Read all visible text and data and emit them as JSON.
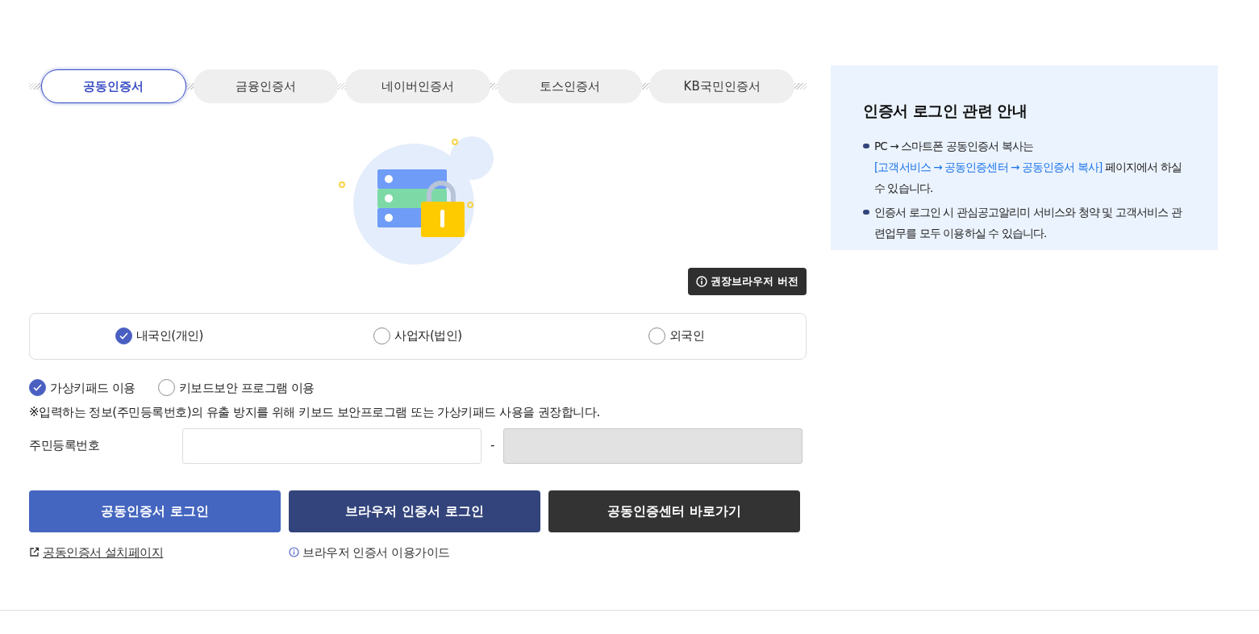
{
  "tabs": [
    {
      "label": "공동인증서",
      "selected": true
    },
    {
      "label": "금융인증서",
      "selected": false
    },
    {
      "label": "네이버인증서",
      "selected": false
    },
    {
      "label": "토스인증서",
      "selected": false
    },
    {
      "label": "KB국민인증서",
      "selected": false
    }
  ],
  "browser_version_button": {
    "label": "권장브라우저 버전"
  },
  "member_types": [
    {
      "label": "내국인(개인)",
      "selected": true
    },
    {
      "label": "사업자(법인)",
      "selected": false
    },
    {
      "label": "외국인",
      "selected": false
    }
  ],
  "input_methods": [
    {
      "label": "가상키패드 이용",
      "selected": true
    },
    {
      "label": "키보드보안 프로그램 이용",
      "selected": false
    }
  ],
  "notice": "※입력하는 정보(주민등록번호)의 유출 방지를 위해 키보드 보안프로그램 또는 가상키패드 사용을 권장합니다.",
  "resident_number": {
    "label": "주민등록번호",
    "separator": "-",
    "fields": [
      {
        "disabled": false
      },
      {
        "disabled": true
      }
    ]
  },
  "buttons": [
    {
      "label": "공동인증서 로그인",
      "kind": "primary"
    },
    {
      "label": "브라우저 인증서 로그인",
      "kind": "navy"
    },
    {
      "label": "공동인증센터 바로가기",
      "kind": "dark"
    }
  ],
  "links": [
    {
      "label": "공동인증서 설치페이지",
      "kind": "external"
    },
    {
      "label": "브라우저 인증서 이용가이드",
      "kind": "info"
    }
  ],
  "guide": {
    "title": "인증서 로그인 관련 안내",
    "items": [
      {
        "before": "PC → 스마트폰 공동인증서 복사는 ",
        "link": "[고객서비스 → 공동인증센터 → 공동인증서 복사]",
        "after": " 페이지에서 하실 수 있습니다."
      },
      {
        "before": "인증서 로그인 시 관심공고알리미 서비스와 청약 및 고객서비스 관련업무를 모두 이용하실 수 있습니다."
      }
    ]
  }
}
